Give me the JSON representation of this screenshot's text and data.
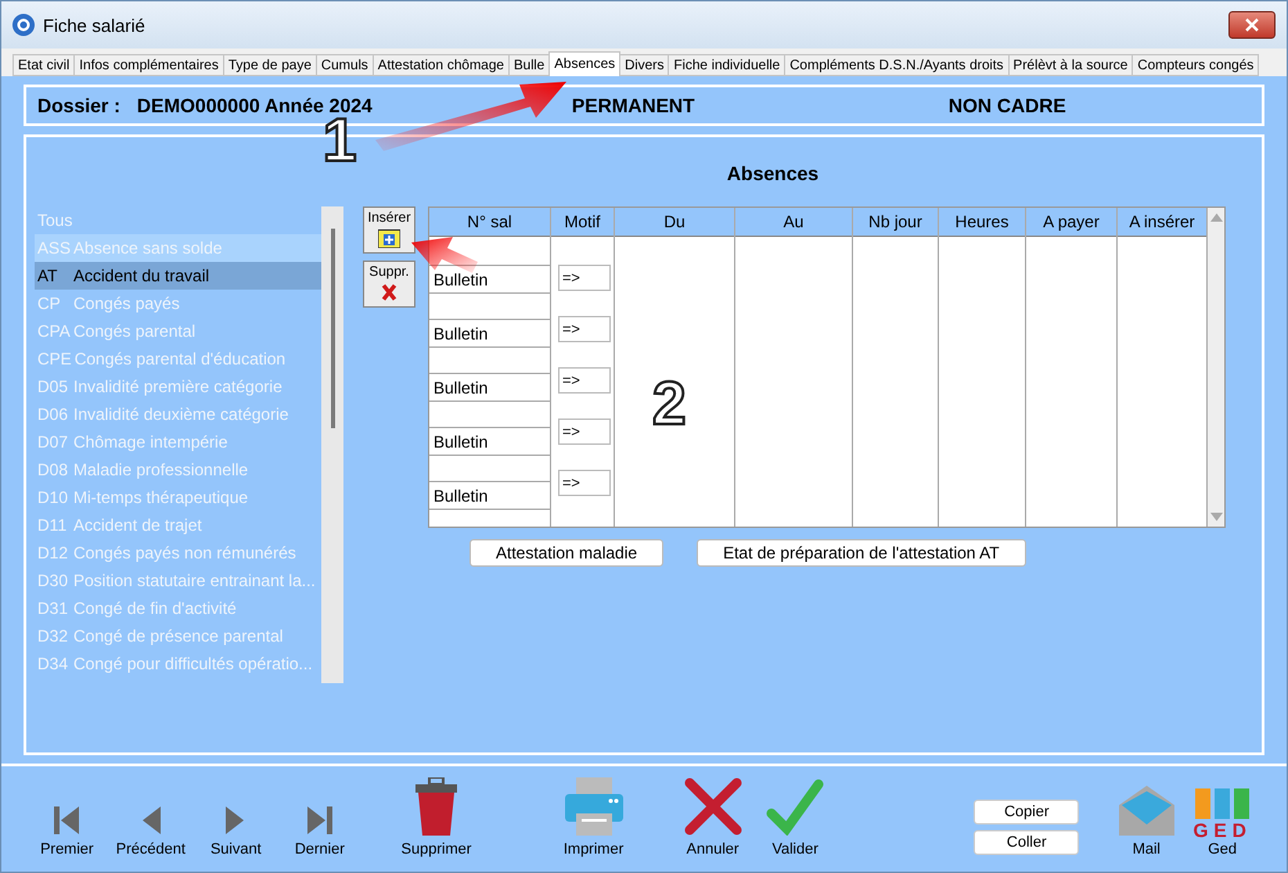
{
  "window": {
    "title": "Fiche salarié"
  },
  "tabs": [
    {
      "label": "Etat civil",
      "selected": false
    },
    {
      "label": "Infos complémentaires",
      "selected": false
    },
    {
      "label": "Type de paye",
      "selected": false
    },
    {
      "label": "Cumuls",
      "selected": false
    },
    {
      "label": "Attestation chômage",
      "selected": false
    },
    {
      "label": "Bulle",
      "selected": false
    },
    {
      "label": "Absences",
      "selected": true
    },
    {
      "label": "Divers",
      "selected": false
    },
    {
      "label": "Fiche individuelle",
      "selected": false
    },
    {
      "label": "Compléments D.S.N./Ayants droits",
      "selected": false
    },
    {
      "label": "Prélèvt à la source",
      "selected": false
    },
    {
      "label": "Compteurs congés",
      "selected": false
    }
  ],
  "header": {
    "dossier_label": "Dossier :",
    "dossier_value": "DEMO000000 Année 2024",
    "status": "PERMANENT",
    "category": "NON CADRE"
  },
  "section_title": "Absences",
  "absence_types": [
    {
      "label": "Tous",
      "selected": false,
      "hovered": false
    },
    {
      "code": "ASS",
      "label": "Absence sans solde",
      "selected": false,
      "hovered": true
    },
    {
      "code": "AT",
      "label": "Accident du travail",
      "selected": true,
      "hovered": false
    },
    {
      "code": "CP",
      "label": "Congés payés",
      "selected": false,
      "hovered": false
    },
    {
      "code": "CPA",
      "label": "Congés parental",
      "selected": false,
      "hovered": false
    },
    {
      "code": "CPE",
      "label": "Congés parental d'éducation",
      "selected": false,
      "hovered": false
    },
    {
      "code": "D05",
      "label": "Invalidité première catégorie",
      "selected": false,
      "hovered": false
    },
    {
      "code": "D06",
      "label": "Invalidité deuxième catégorie",
      "selected": false,
      "hovered": false
    },
    {
      "code": "D07",
      "label": "Chômage intempérie",
      "selected": false,
      "hovered": false
    },
    {
      "code": "D08",
      "label": "Maladie professionnelle",
      "selected": false,
      "hovered": false
    },
    {
      "code": "D10",
      "label": "Mi-temps thérapeutique",
      "selected": false,
      "hovered": false
    },
    {
      "code": "D11",
      "label": "Accident de trajet",
      "selected": false,
      "hovered": false
    },
    {
      "code": "D12",
      "label": "Congés payés non rémunérés",
      "selected": false,
      "hovered": false
    },
    {
      "code": "D30",
      "label": "Position statutaire entrainant la...",
      "selected": false,
      "hovered": false
    },
    {
      "code": "D31",
      "label": "Congé de fin d'activité",
      "selected": false,
      "hovered": false
    },
    {
      "code": "D32",
      "label": "Congé de présence parental",
      "selected": false,
      "hovered": false
    },
    {
      "code": "D34",
      "label": "Congé pour difficultés opératio...",
      "selected": false,
      "hovered": false
    }
  ],
  "side_buttons": [
    {
      "kind": "insert",
      "label": "Insérer"
    },
    {
      "kind": "delete",
      "label": "Suppr."
    }
  ],
  "table": {
    "columns": [
      "N° sal",
      "Motif",
      "Du",
      "Au",
      "Nb jour",
      "Heures",
      "A payer",
      "A insérer"
    ],
    "rows": [
      {
        "n_sal": "Bulletin",
        "motif": "=>"
      },
      {
        "n_sal": "Bulletin",
        "motif": "=>"
      },
      {
        "n_sal": "Bulletin",
        "motif": "=>"
      },
      {
        "n_sal": "Bulletin",
        "motif": "=>"
      },
      {
        "n_sal": "Bulletin",
        "motif": "=>"
      }
    ]
  },
  "action_buttons": [
    "Attestation maladie",
    "Etat de préparation de l'attestation AT"
  ],
  "annotations": [
    {
      "number": "1"
    },
    {
      "number": "2"
    }
  ],
  "toolbar": [
    {
      "kind": "first",
      "label": "Premier"
    },
    {
      "kind": "prev",
      "label": "Précédent"
    },
    {
      "kind": "next",
      "label": "Suivant"
    },
    {
      "kind": "last",
      "label": "Dernier"
    },
    {
      "kind": "trash",
      "label": "Supprimer"
    },
    {
      "kind": "print",
      "label": "Imprimer"
    },
    {
      "kind": "cancel",
      "label": "Annuler"
    },
    {
      "kind": "validate",
      "label": "Valider"
    }
  ],
  "clipboard_buttons": [
    "Copier",
    "Coller"
  ],
  "mail": {
    "label": "Mail"
  },
  "ged": {
    "logo": "GED",
    "label": "Ged"
  }
}
